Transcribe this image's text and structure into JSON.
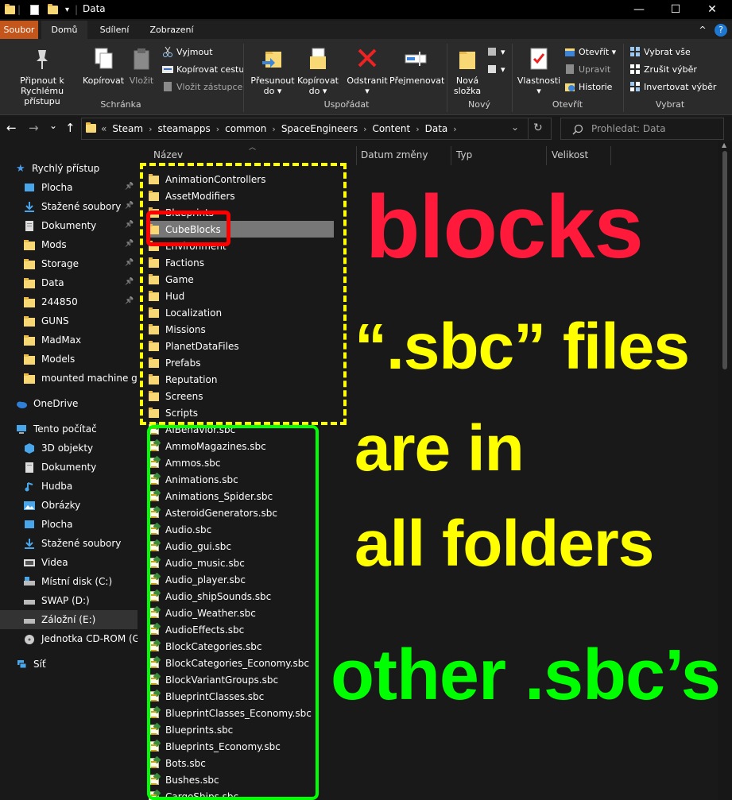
{
  "window": {
    "title": "Data",
    "controls": {
      "minimize": "—",
      "maximize": "☐",
      "close": "✕"
    }
  },
  "ribbon": {
    "tabs": [
      "Soubor",
      "Domů",
      "Sdílení",
      "Zobrazení"
    ],
    "groups": {
      "clipboard": {
        "label": "Schránka",
        "pin_line1": "Připnout k",
        "pin_line2": "Rychlému přístupu",
        "copy": "Kopírovat",
        "paste": "Vložit",
        "cut": "Vyjmout",
        "copy_path": "Kopírovat cestu",
        "paste_shortcut": "Vložit zástupce"
      },
      "organize": {
        "label": "Uspořádat",
        "move_line1": "Přesunout",
        "move_line2": "do ▾",
        "copyto_line1": "Kopírovat",
        "copyto_line2": "do ▾",
        "delete_line1": "Odstranit",
        "delete_line2": "▾",
        "rename": "Přejmenovat"
      },
      "new": {
        "label": "Nový",
        "new_folder_line1": "Nová",
        "new_folder_line2": "složka"
      },
      "open": {
        "label": "Otevřít",
        "properties_line1": "Vlastnosti",
        "properties_line2": "▾",
        "open": "Otevřít ▾",
        "edit": "Upravit",
        "history": "Historie"
      },
      "select": {
        "label": "Vybrat",
        "select_all": "Vybrat vše",
        "select_none": "Zrušit výběr",
        "invert": "Invertovat výběr"
      }
    },
    "collapse": "^",
    "help": "?"
  },
  "nav": {
    "back": "←",
    "forward": "→",
    "recent": "⌄",
    "up": "↑",
    "overflow": "«",
    "breadcrumbs": [
      "Steam",
      "steamapps",
      "common",
      "SpaceEngineers",
      "Content",
      "Data"
    ],
    "dropdown": "⌄",
    "refresh": "↻",
    "search_placeholder": "Prohledat: Data"
  },
  "navpane": {
    "quick_access": "Rychlý přístup",
    "quick_items": [
      "Plocha",
      "Stažené soubory",
      "Dokumenty",
      "Mods",
      "Storage",
      "Data",
      "244850",
      "GUNS",
      "MadMax",
      "Models",
      "mounted machine gun"
    ],
    "onedrive": "OneDrive",
    "this_pc": "Tento počítač",
    "pc_items": [
      "3D objekty",
      "Dokumenty",
      "Hudba",
      "Obrázky",
      "Plocha",
      "Stažené soubory",
      "Videa",
      "Místní disk (C:)",
      "SWAP (D:)",
      "Záložní (E:)",
      "Jednotka CD-ROM (G:)"
    ],
    "network": "Síť"
  },
  "filelist": {
    "columns": [
      "Název",
      "Datum změny",
      "Typ",
      "Velikost"
    ],
    "folders": [
      "AnimationControllers",
      "AssetModifiers",
      "Blueprints",
      "CubeBlocks",
      "Environment",
      "Factions",
      "Game",
      "Hud",
      "Localization",
      "Missions",
      "PlanetDataFiles",
      "Prefabs",
      "Reputation",
      "Screens",
      "Scripts"
    ],
    "files": [
      "AIBehavior.sbc",
      "AmmoMagazines.sbc",
      "Ammos.sbc",
      "Animations.sbc",
      "Animations_Spider.sbc",
      "AsteroidGenerators.sbc",
      "Audio.sbc",
      "Audio_gui.sbc",
      "Audio_music.sbc",
      "Audio_player.sbc",
      "Audio_shipSounds.sbc",
      "Audio_Weather.sbc",
      "AudioEffects.sbc",
      "BlockCategories.sbc",
      "BlockCategories_Economy.sbc",
      "BlockVariantGroups.sbc",
      "BlueprintClasses.sbc",
      "BlueprintClasses_Economy.sbc",
      "Blueprints.sbc",
      "Blueprints_Economy.sbc",
      "Bots.sbc",
      "Bushes.sbc",
      "CargoShips.sbc"
    ]
  },
  "annotations": {
    "blocks": "blocks",
    "sbc_line1": "“.sbc” files",
    "sbc_line2": "are in",
    "sbc_line3": "all folders",
    "other": "other .sbc’s",
    "colors": {
      "red": "#ff1a3b",
      "yellow": "#ffff00",
      "green": "#00ff00"
    }
  }
}
